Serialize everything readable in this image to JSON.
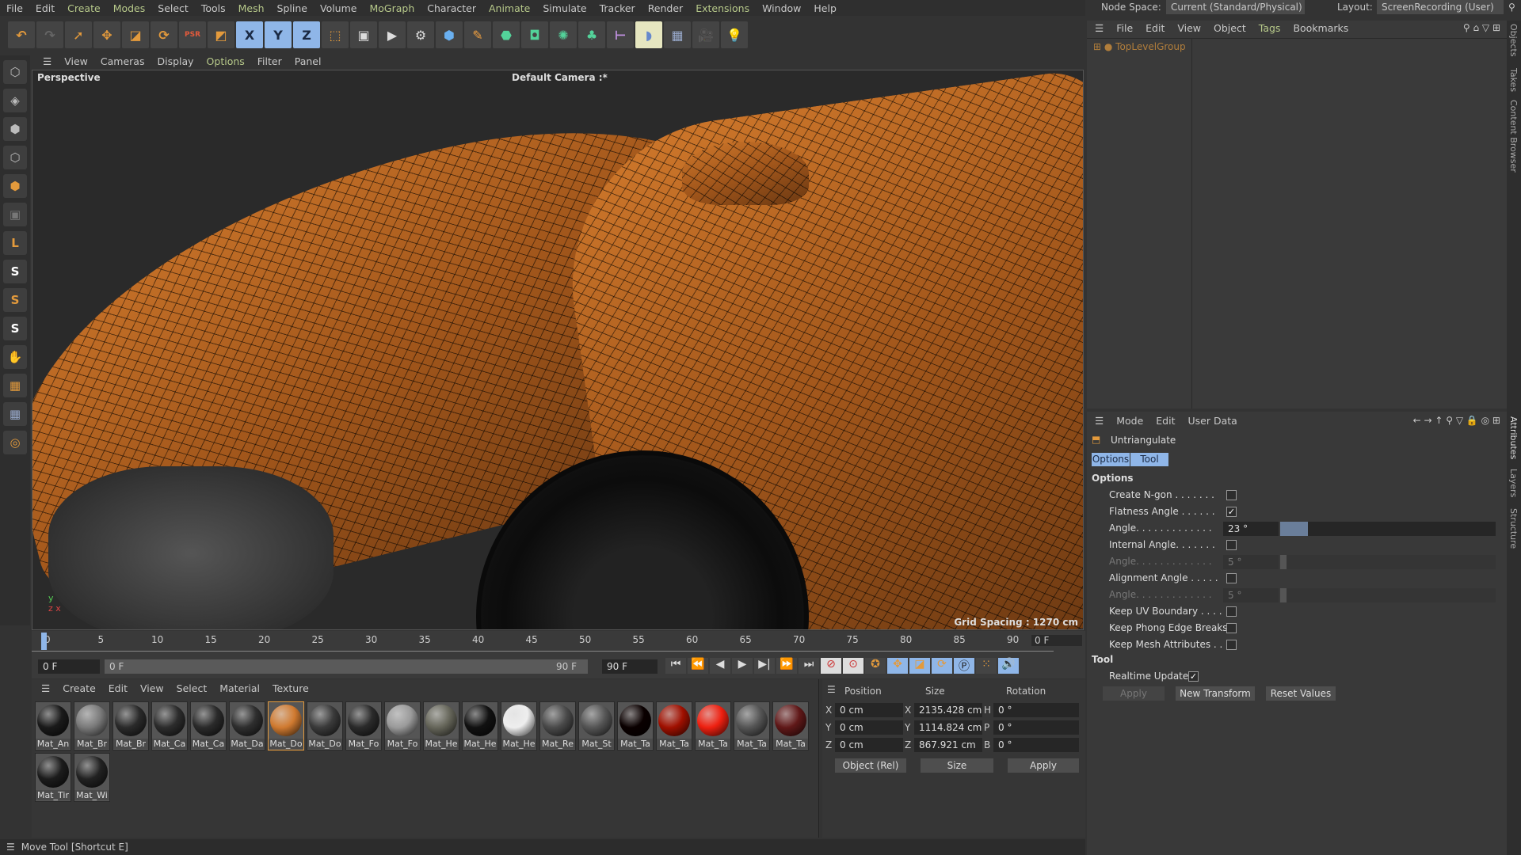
{
  "menubar": [
    "File",
    "Edit",
    "Create",
    "Modes",
    "Select",
    "Tools",
    "Mesh",
    "Spline",
    "Volume",
    "MoGraph",
    "Character",
    "Animate",
    "Simulate",
    "Tracker",
    "Render",
    "Extensions",
    "Window",
    "Help"
  ],
  "toolbar": {
    "axis": [
      "X",
      "Y",
      "Z"
    ],
    "psr": "PSR"
  },
  "viewport": {
    "menu": [
      "View",
      "Cameras",
      "Display",
      "Options",
      "Filter",
      "Panel"
    ],
    "label": "Perspective",
    "camera": "Default Camera :*",
    "grid": "Grid Spacing : 1270 cm"
  },
  "timeline": {
    "ticks": [
      "0",
      "5",
      "10",
      "15",
      "20",
      "25",
      "30",
      "35",
      "40",
      "45",
      "50",
      "55",
      "60",
      "65",
      "70",
      "75",
      "80",
      "85",
      "90"
    ],
    "current": "0 F",
    "start": "0 F",
    "range_start": "0 F",
    "range_end": "90 F",
    "end": "90 F"
  },
  "materials": {
    "menu": [
      "Create",
      "Edit",
      "View",
      "Select",
      "Material",
      "Texture"
    ],
    "items": [
      {
        "name": "Mat_An",
        "color": "#1a1a1a"
      },
      {
        "name": "Mat_Br",
        "color": "#7a7a7a"
      },
      {
        "name": "Mat_Br",
        "color": "#2a2a2a"
      },
      {
        "name": "Mat_Ca",
        "color": "#2c2c2c"
      },
      {
        "name": "Mat_Ca",
        "color": "#2a2a2a"
      },
      {
        "name": "Mat_Da",
        "color": "#2e2e2e"
      },
      {
        "name": "Mat_Do",
        "color": "#d07a30"
      },
      {
        "name": "Mat_Do",
        "color": "#3a3a3a"
      },
      {
        "name": "Mat_Fo",
        "color": "#2a2a2a"
      },
      {
        "name": "Mat_Fo",
        "color": "#9a9a9a"
      },
      {
        "name": "Mat_He",
        "color": "#66665a"
      },
      {
        "name": "Mat_He",
        "color": "#111"
      },
      {
        "name": "Mat_He",
        "color": "#eeeeee"
      },
      {
        "name": "Mat_Re",
        "color": "#4a4a4a"
      },
      {
        "name": "Mat_St",
        "color": "#555"
      },
      {
        "name": "Mat_Ta",
        "color": "#0a0000"
      },
      {
        "name": "Mat_Ta",
        "color": "#a01000"
      },
      {
        "name": "Mat_Ta",
        "color": "#ee2010"
      },
      {
        "name": "Mat_Ta",
        "color": "#555"
      },
      {
        "name": "Mat_Ta",
        "color": "#601818"
      },
      {
        "name": "Mat_Tir",
        "color": "#1c1c1c"
      },
      {
        "name": "Mat_Wi",
        "color": "#222"
      }
    ]
  },
  "coords": {
    "headers": [
      "Position",
      "Size",
      "Rotation"
    ],
    "rows": [
      {
        "pl": "X",
        "p": "0 cm",
        "sl": "X",
        "s": "2135.428 cm",
        "rl": "H",
        "r": "0 °"
      },
      {
        "pl": "Y",
        "p": "0 cm",
        "sl": "Y",
        "s": "1114.824 cm",
        "rl": "P",
        "r": "0 °"
      },
      {
        "pl": "Z",
        "p": "0 cm",
        "sl": "Z",
        "s": "867.921 cm",
        "rl": "B",
        "r": "0 °"
      }
    ],
    "mode": "Object (Rel)",
    "size_mode": "Size",
    "apply": "Apply"
  },
  "status": "Move Tool [Shortcut E]",
  "top_right": {
    "node_space_label": "Node Space:",
    "node_space": "Current (Standard/Physical)",
    "layout_label": "Layout:",
    "layout": "ScreenRecording (User)"
  },
  "objects": {
    "menu": [
      "File",
      "Edit",
      "View",
      "Object",
      "Tags",
      "Bookmarks"
    ],
    "item": "TopLevelGroup"
  },
  "attributes": {
    "menu": [
      "Mode",
      "Edit",
      "User Data"
    ],
    "tool_name": "Untriangulate",
    "tabs": [
      "Options",
      "Tool"
    ],
    "section_options": "Options",
    "options": [
      {
        "label": "Create N-gon . . . . . . .",
        "checked": false
      },
      {
        "label": "Flatness Angle . . . . . .",
        "checked": true
      },
      {
        "label": "Angle. . . . . . . . . . . . .",
        "value": "23 °",
        "slider": 0.13
      },
      {
        "label": "Internal Angle. . . . . . .",
        "checked": false
      },
      {
        "label": "Angle. . . . . . . . . . . . .",
        "value": "5 °",
        "disabled": true
      },
      {
        "label": "Alignment Angle . . . . .",
        "checked": false
      },
      {
        "label": "Angle. . . . . . . . . . . . .",
        "value": "5 °",
        "disabled": true
      },
      {
        "label": "Keep UV Boundary . . . .",
        "checked": false
      },
      {
        "label": "Keep Phong Edge Breaks",
        "checked": false
      },
      {
        "label": "Keep Mesh Attributes . .",
        "checked": false
      }
    ],
    "section_tool": "Tool",
    "realtime": "Realtime Update",
    "realtime_checked": true,
    "buttons": [
      "Apply",
      "New Transform",
      "Reset Values"
    ]
  },
  "side_tabs": [
    "Objects",
    "Takes",
    "Content Browser",
    "Attributes",
    "Layers",
    "Structure"
  ],
  "colors": {
    "accent": "#e39a3c",
    "tab_blue": "#8fb6e8"
  }
}
